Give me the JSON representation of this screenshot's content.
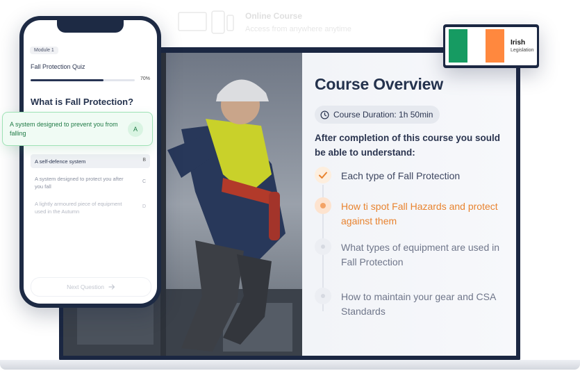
{
  "header_ghost": {
    "line1": "Online Course",
    "line2": "Access from anywhere anytime"
  },
  "course": {
    "title": "Course Overview",
    "duration": "Course Duration: 1h 50min",
    "intro": "After completion of this course you sould be able to understand:",
    "steps": [
      {
        "label": "Each type of Fall Protection",
        "status": "done"
      },
      {
        "label": "How ti spot Fall Hazards and protect against them",
        "status": "active"
      },
      {
        "label": "What types of equipment are used in Fall Protection",
        "status": "pending"
      },
      {
        "label": "How to maintain your gear and CSA Standards",
        "status": "pending"
      }
    ]
  },
  "badge": {
    "title": "Irish",
    "subtitle": "Legislation",
    "flag_colors": [
      "#169b62",
      "#ffffff",
      "#ff883e"
    ]
  },
  "quiz": {
    "module": "Module 1",
    "title": "Fall Protection Quiz",
    "progress_pct": 70,
    "progress_text": "70%",
    "question": "What is Fall Protection?",
    "options": [
      {
        "text": "A system designed to prevent you from falling",
        "letter": "A",
        "state": "selected-correct"
      },
      {
        "text": "A self-defence system",
        "letter": "B",
        "state": "default"
      },
      {
        "text": "A system designed to protect you after you fall",
        "letter": "C",
        "state": "default"
      },
      {
        "text": "A lightly armoured piece of equipment used in the Autumn",
        "letter": "D",
        "state": "default"
      }
    ],
    "next_button": "Next Question"
  },
  "colors": {
    "accent": "#e8832f",
    "navy": "#24324d",
    "correct": "#1f7a45"
  }
}
